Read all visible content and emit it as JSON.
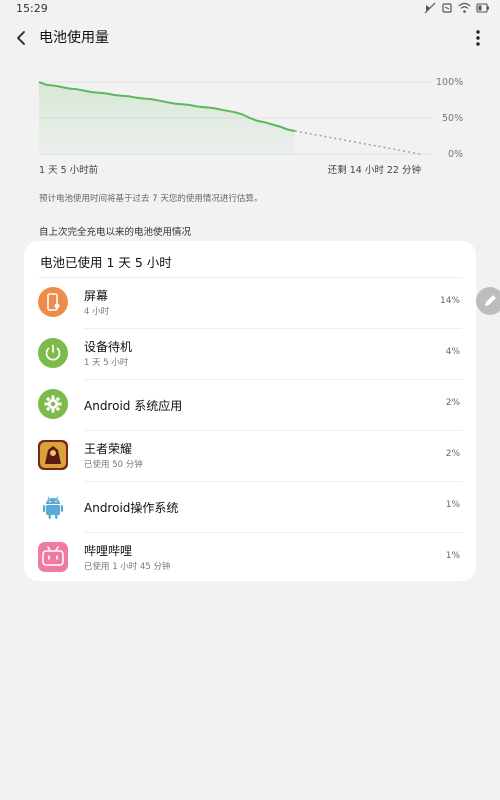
{
  "status_bar": {
    "time": "15:29"
  },
  "header": {
    "title": "电池使用量"
  },
  "chart": {
    "y_ticks": [
      "100%",
      "50%",
      "0%"
    ],
    "left_label": "1 天 5 小时前",
    "right_label": "还剩 14 小时 22 分钟",
    "series_color": "#5cb85c",
    "projection_color": "#9e9e9e"
  },
  "chart_data": {
    "type": "line",
    "title": "",
    "xlabel": "",
    "ylabel": "",
    "ylim": [
      0,
      100
    ],
    "grid": true,
    "series": [
      {
        "values": [
          100,
          96,
          95,
          93,
          91,
          90,
          88,
          86,
          85,
          84,
          82,
          81,
          80,
          78,
          77,
          76,
          74,
          72,
          70,
          69,
          68,
          66,
          65,
          64,
          62,
          60,
          58,
          55,
          50,
          46,
          44,
          41,
          38,
          34,
          32
        ]
      }
    ],
    "projection": {
      "start": 32,
      "end": 0
    }
  },
  "note": "预计电池使用时间将基于过去 7 天您的使用情况进行估算。",
  "section_label": "自上次完全充电以来的电池使用情况",
  "card": {
    "title": "电池已使用 1 天 5 小时",
    "items": [
      {
        "name": "屏幕",
        "sub": "4 小时",
        "pct": "14%",
        "icon": "screen-icon",
        "color": "#f08c4a"
      },
      {
        "name": "设备待机",
        "sub": "1 天 5 小时",
        "pct": "4%",
        "icon": "power-icon",
        "color": "#7cbb4a"
      },
      {
        "name": "Android 系统应用",
        "sub": "",
        "pct": "2%",
        "icon": "settings-gear-icon",
        "color": "#7cbb4a"
      },
      {
        "name": "王者荣耀",
        "sub": "已使用 50 分钟",
        "pct": "2%",
        "icon": "honor-of-kings-app-icon",
        "color": "#c0392b"
      },
      {
        "name": "Android操作系统",
        "sub": "",
        "pct": "1%",
        "icon": "android-icon",
        "color": "#5aa9d6"
      },
      {
        "name": "哔哩哔哩",
        "sub": "已使用 1 小时 45 分钟",
        "pct": "1%",
        "icon": "bilibili-app-icon",
        "color": "#f07aa0"
      }
    ]
  }
}
